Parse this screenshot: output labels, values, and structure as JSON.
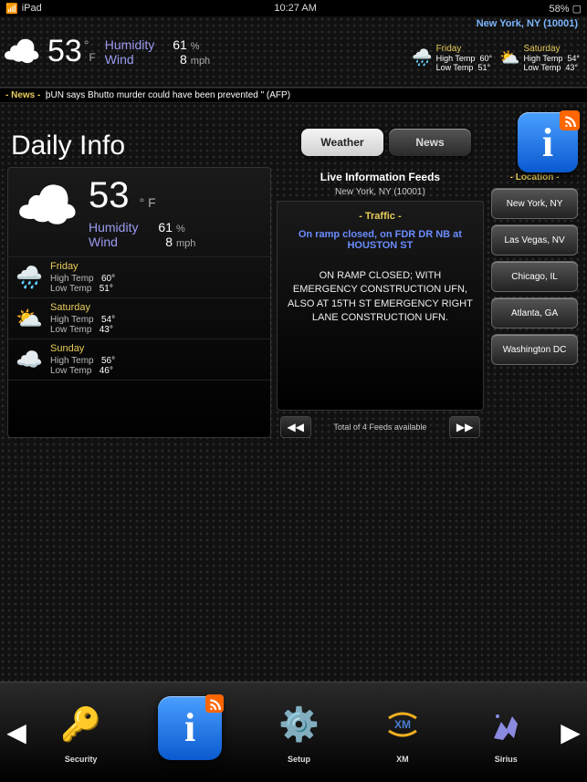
{
  "statusbar": {
    "device": "iPad",
    "time": "10:27 AM",
    "battery": "58%"
  },
  "top": {
    "location": "New York, NY (10001)",
    "temp": "53",
    "unit": "F",
    "humidity_label": "Humidity",
    "humidity": "61",
    "humidity_unit": "%",
    "wind_label": "Wind",
    "wind": "8",
    "wind_unit": "mph",
    "days": [
      {
        "name": "Friday",
        "hi_label": "High Temp",
        "hi": "60°",
        "lo_label": "Low Temp",
        "lo": "51°"
      },
      {
        "name": "Saturday",
        "hi_label": "High Temp",
        "hi": "54°",
        "lo_label": "Low Temp",
        "lo": "43°"
      }
    ]
  },
  "ticker": {
    "label": "- News -",
    "text": "þUN says Bhutto murder could have been prevented \" (AFP)"
  },
  "page": {
    "title": "Daily Info"
  },
  "tabs": {
    "weather": "Weather",
    "news": "News"
  },
  "feeds": {
    "heading": "Live Information Feeds",
    "sub": "New York, NY (10001)",
    "section": "- Traffic -",
    "headline": "On ramp closed, on FDR DR NB at HOUSTON ST",
    "body": "ON RAMP CLOSED; WITH EMERGENCY CONSTRUCTION UFN, ALSO AT 15TH ST EMERGENCY RIGHT LANE CONSTRUCTION UFN.",
    "count": "Total of 4 Feeds available"
  },
  "current": {
    "temp": "53",
    "unit": "F",
    "humidity_label": "Humidity",
    "humidity": "61",
    "humidity_unit": "%",
    "wind_label": "Wind",
    "wind": "8",
    "wind_unit": "mph"
  },
  "forecast": [
    {
      "day": "Friday",
      "hi_label": "High Temp",
      "hi": "60°",
      "lo_label": "Low Temp",
      "lo": "51°"
    },
    {
      "day": "Saturday",
      "hi_label": "High Temp",
      "hi": "54°",
      "lo_label": "Low Temp",
      "lo": "43°"
    },
    {
      "day": "Sunday",
      "hi_label": "High Temp",
      "hi": "56°",
      "lo_label": "Low Temp",
      "lo": "46°"
    }
  ],
  "locations": {
    "label": "- Location -",
    "items": [
      "New York, NY",
      "Las Vegas, NV",
      "Chicago, IL",
      "Atlanta, GA",
      "Washington DC"
    ]
  },
  "dock": {
    "items": [
      {
        "label": "Security"
      },
      {
        "label": ""
      },
      {
        "label": "Setup"
      },
      {
        "label": "XM"
      },
      {
        "label": "Sirius"
      }
    ]
  }
}
